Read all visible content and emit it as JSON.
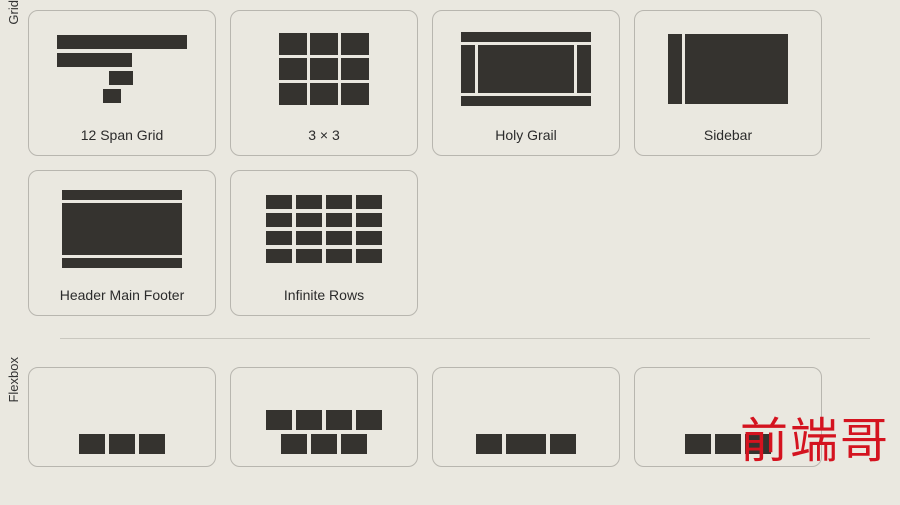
{
  "sections": [
    {
      "label": "Grid",
      "items": [
        {
          "label": "12 Span Grid"
        },
        {
          "label": "3 × 3"
        },
        {
          "label": "Holy Grail"
        },
        {
          "label": "Sidebar"
        },
        {
          "label": "Header Main Footer"
        },
        {
          "label": "Infinite Rows"
        }
      ]
    },
    {
      "label": "Flexbox",
      "items": [
        {
          "label": ""
        },
        {
          "label": ""
        },
        {
          "label": ""
        },
        {
          "label": ""
        }
      ]
    }
  ],
  "watermark": "前端哥"
}
